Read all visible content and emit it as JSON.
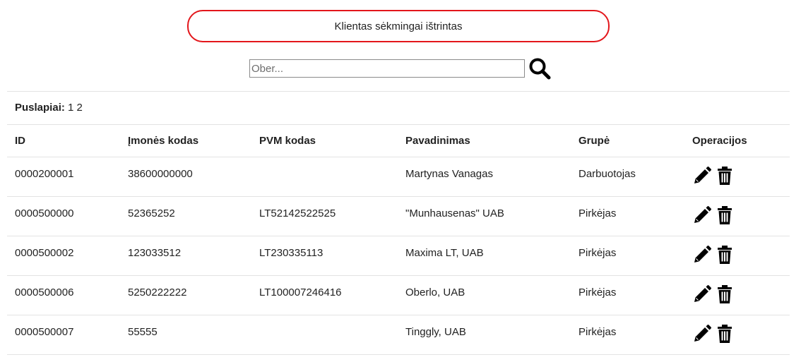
{
  "alert": {
    "message": "Klientas sėkmingai ištrintas",
    "border_color": "#e3161b"
  },
  "search": {
    "placeholder": "Ober...",
    "value": "",
    "icon": "search-icon"
  },
  "pagination": {
    "label": "Puslapiai:",
    "pages": [
      "1",
      "2"
    ]
  },
  "table": {
    "headers": [
      "ID",
      "Įmonės kodas",
      "PVM kodas",
      "Pavadinimas",
      "Grupė",
      "Operacijos"
    ],
    "rows": [
      {
        "id": "0000200001",
        "imones_kodas": "38600000000",
        "pvm_kodas": "",
        "pavadinimas": "Martynas Vanagas",
        "grupe": "Darbuotojas"
      },
      {
        "id": "0000500000",
        "imones_kodas": "52365252",
        "pvm_kodas": "LT52142522525",
        "pavadinimas": "\"Munhausenas\" UAB",
        "grupe": "Pirkėjas"
      },
      {
        "id": "0000500002",
        "imones_kodas": "123033512",
        "pvm_kodas": "LT230335113",
        "pavadinimas": "Maxima LT, UAB",
        "grupe": "Pirkėjas"
      },
      {
        "id": "0000500006",
        "imones_kodas": "5250222222",
        "pvm_kodas": "LT100007246416",
        "pavadinimas": "Oberlo, UAB",
        "grupe": "Pirkėjas"
      },
      {
        "id": "0000500007",
        "imones_kodas": "55555",
        "pvm_kodas": "",
        "pavadinimas": "Tinggly, UAB",
        "grupe": "Pirkėjas"
      }
    ],
    "operation_icons": [
      "pencil-icon",
      "trash-icon"
    ]
  }
}
